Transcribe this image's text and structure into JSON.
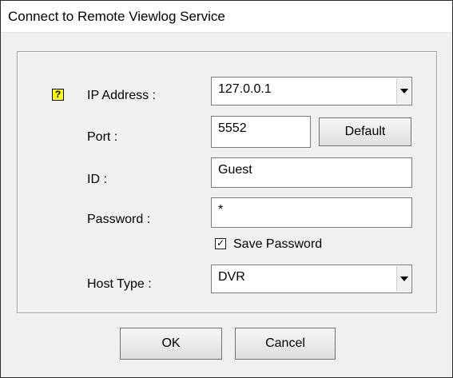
{
  "dialog": {
    "title": "Connect to Remote Viewlog Service"
  },
  "form": {
    "ip_label": "IP Address :",
    "ip_value": "127.0.0.1",
    "port_label": "Port :",
    "port_value": "5552",
    "default_button": "Default",
    "id_label": "ID :",
    "id_value": "Guest",
    "password_label": "Password :",
    "password_value": "*",
    "save_password_label": "Save Password",
    "save_password_checked": true,
    "host_type_label": "Host Type :",
    "host_type_value": "DVR"
  },
  "buttons": {
    "ok": "OK",
    "cancel": "Cancel"
  },
  "icons": {
    "help": "help-icon",
    "dropdown": "chevron-down-icon",
    "check": "checkmark-icon"
  },
  "colors": {
    "dialog_bg": "#f0f0f0",
    "help_icon_bg": "#ffff00"
  }
}
